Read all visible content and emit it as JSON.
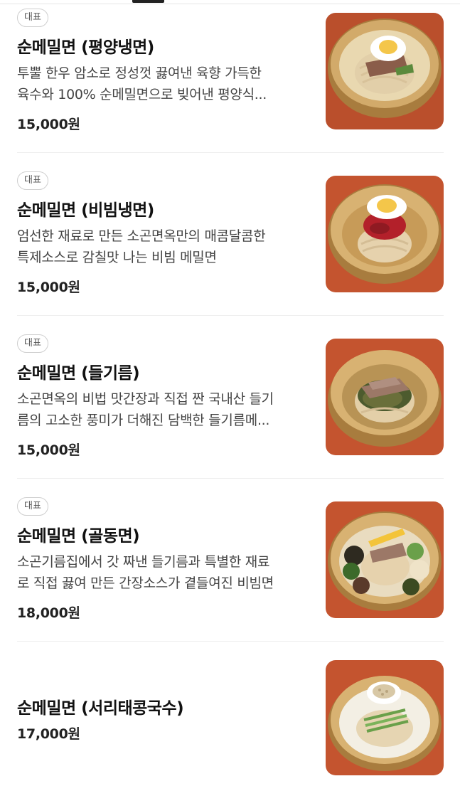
{
  "badge_label": "대표",
  "items": [
    {
      "name": "순메밀면 (평양냉면)",
      "desc_line1": "투뿔 한우 암소로 정성껏 끓여낸 육향 가득한",
      "desc_line2": "육수와 100% 순메밀면으로 빚어낸 평양식...",
      "price": "15,000원",
      "image_icon": "pyongyang-naengmyeon-bowl"
    },
    {
      "name": "순메밀면 (비빔냉면)",
      "desc_line1": "엄선한 재료로 만든 소곤면옥만의 매콤달콤한",
      "desc_line2": "특제소스로 감칠맛 나는 비빔 메밀면",
      "price": "15,000원",
      "image_icon": "bibim-naengmyeon-bowl"
    },
    {
      "name": "순메밀면 (들기름)",
      "desc_line1": "소곤면옥의 비법 맛간장과 직접 짠 국내산 들기",
      "desc_line2": "름의 고소한 풍미가 더해진 담백한 들기름메...",
      "price": "15,000원",
      "image_icon": "perilla-oil-noodle-bowl"
    },
    {
      "name": "순메밀면 (골동면)",
      "desc_line1": "소곤기름집에서 갓 짜낸 들기름과 특별한 재료",
      "desc_line2": "로 직접 끓여 만든 간장소스가 곁들여진 비빔면",
      "price": "18,000원",
      "image_icon": "goldong-noodle-bowl"
    },
    {
      "name": "순메밀면 (서리태콩국수)",
      "price": "17,000원",
      "image_icon": "black-soybean-noodle-bowl"
    }
  ],
  "colors": {
    "background_wood": "#c4542f",
    "bowl_brass": "#c9a060",
    "noodle": "#e8d6b8"
  }
}
